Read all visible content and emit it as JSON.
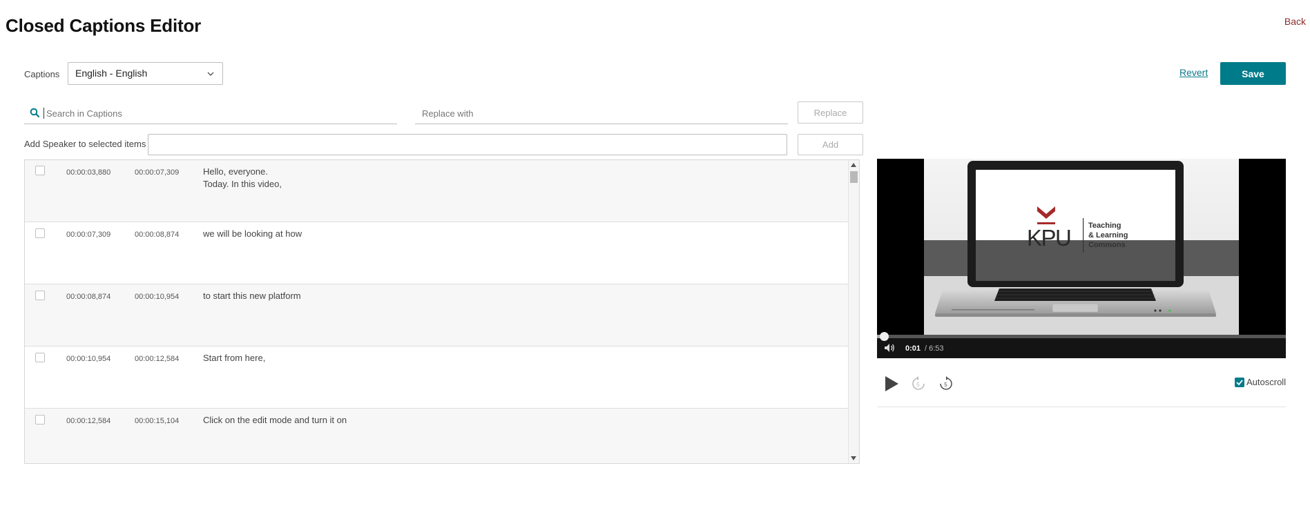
{
  "page": {
    "title": "Closed Captions Editor",
    "back_label": "Back"
  },
  "toolbar": {
    "captions_label": "Captions",
    "language_selected": "English - English",
    "revert_label": "Revert",
    "save_label": "Save"
  },
  "search": {
    "placeholder": "Search in Captions",
    "replace_placeholder": "Replace with",
    "replace_label": "Replace"
  },
  "speaker": {
    "label": "Add Speaker to selected items",
    "add_label": "Add"
  },
  "captions": [
    {
      "start": "00:00:03,880",
      "end": "00:00:07,309",
      "lines": [
        "Hello, everyone.",
        "Today. In this video,"
      ]
    },
    {
      "start": "00:00:07,309",
      "end": "00:00:08,874",
      "lines": [
        "we will be looking at how"
      ]
    },
    {
      "start": "00:00:08,874",
      "end": "00:00:10,954",
      "lines": [
        "to start this new platform"
      ]
    },
    {
      "start": "00:00:10,954",
      "end": "00:00:12,584",
      "lines": [
        "Start from here,"
      ]
    },
    {
      "start": "00:00:12,584",
      "end": "00:00:15,104",
      "lines": [
        "Click on the edit mode and turn it on"
      ]
    }
  ],
  "player": {
    "current_time": "0:01",
    "duration": "/ 6:53",
    "progress_fraction": 0.003,
    "logo_text": "KPU",
    "logo_tagline": [
      "Teaching",
      "& Learning",
      "Commons"
    ]
  },
  "controls": {
    "autoscroll_label": "Autoscroll",
    "autoscroll_checked": true
  },
  "colors": {
    "accent": "#007b8a",
    "back_link": "#8a2b2b",
    "logo_red": "#a52a2a"
  },
  "icons": {
    "search": "search-icon",
    "chevron": "chevron-down-icon",
    "play": "play-icon",
    "rewind": "rewind-5-icon",
    "forward": "forward-5-icon",
    "volume": "volume-icon",
    "check": "check-icon"
  }
}
